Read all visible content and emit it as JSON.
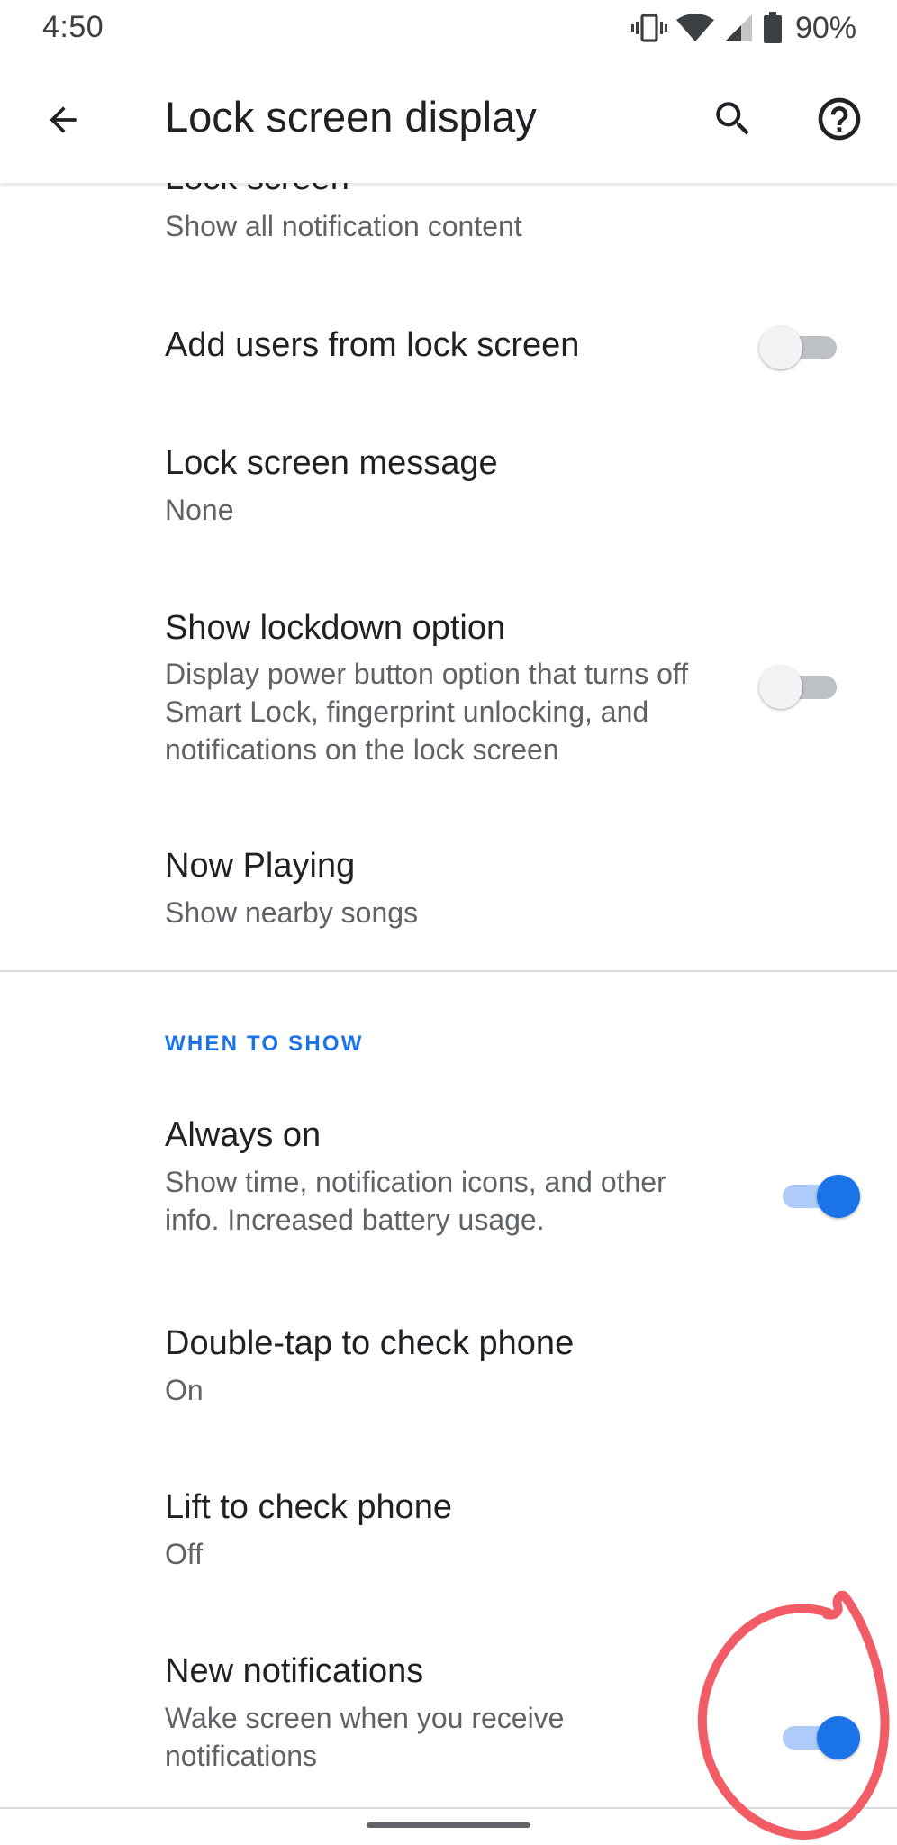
{
  "status_bar": {
    "time": "4:50",
    "battery_percent": "90%",
    "icons": [
      "vibrate-icon",
      "wifi-icon",
      "cell-signal-icon",
      "battery-icon"
    ]
  },
  "app_bar": {
    "title": "Lock screen display",
    "icons": [
      "arrow-back-icon",
      "search-icon",
      "help-icon"
    ]
  },
  "items": {
    "lock_screen": {
      "title": "Lock screen",
      "summary": "Show all notification content"
    },
    "add_users": {
      "title": "Add users from lock screen",
      "toggle_on": false
    },
    "lock_message": {
      "title": "Lock screen message",
      "summary": "None"
    },
    "lockdown": {
      "title": "Show lockdown option",
      "summary": "Display power button option that turns off Smart Lock, fingerprint unlocking, and notifications on the lock screen",
      "toggle_on": false
    },
    "now_playing": {
      "title": "Now Playing",
      "summary": "Show nearby songs"
    }
  },
  "when_to_show": {
    "header": "WHEN TO SHOW",
    "always_on": {
      "title": "Always on",
      "summary": "Show time, notification icons, and other info. Increased battery usage.",
      "toggle_on": true
    },
    "double_tap": {
      "title": "Double-tap to check phone",
      "summary": "On"
    },
    "lift": {
      "title": "Lift to check phone",
      "summary": "Off"
    },
    "new_notifications": {
      "title": "New notifications",
      "summary": "Wake screen when you receive notifications",
      "toggle_on": true
    }
  },
  "colors": {
    "accent": "#1a73e8",
    "annotation": "#f25c66",
    "text_primary": "#202124",
    "text_secondary": "#5f6368"
  }
}
